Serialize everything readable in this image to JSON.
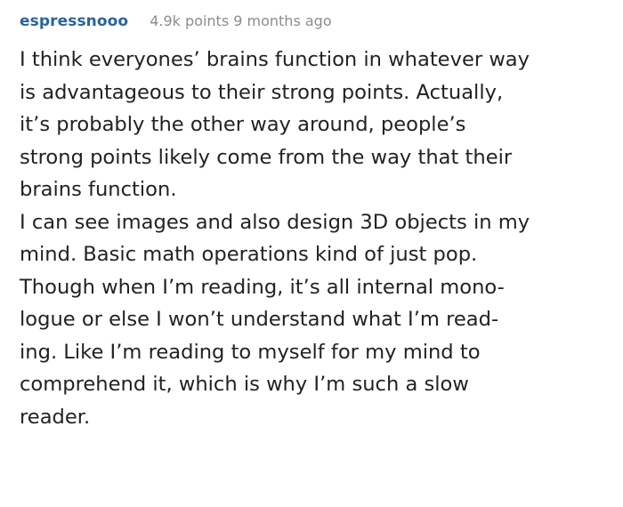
{
  "comment": {
    "author": "espressnooo",
    "meta": "4.9k points 9 months ago",
    "lines": [
      "I think everyones’ brains function in whatever way",
      "is advantageous to their strong points. Actually,",
      "it’s probably the other way around, people’s",
      "strong points likely come from the way that their",
      "brains function.",
      "I can see images and also design 3D objects in my",
      "mind. Basic math operations kind of just pop.",
      "Though when I’m reading, it’s all internal mono-",
      "logue or else I won’t understand what I’m read-",
      "ing. Like I’m reading to myself for my mind to",
      "comprehend it, which is why I’m such a slow",
      "reader."
    ]
  },
  "colors": {
    "username": "#2a6496",
    "meta": "#8c8c8c",
    "text": "#222222",
    "background": "#ffffff"
  }
}
